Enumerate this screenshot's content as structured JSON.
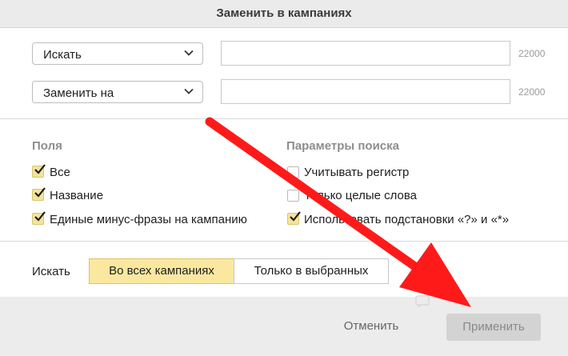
{
  "dialog": {
    "title": "Заменить в кампаниях"
  },
  "find_row": {
    "select_value": "Искать",
    "input_value": "",
    "counter": "22000"
  },
  "replace_row": {
    "select_value": "Заменить на",
    "input_value": "",
    "counter": "22000"
  },
  "fields": {
    "title": "Поля",
    "items": [
      {
        "label": "Все",
        "checked": true
      },
      {
        "label": "Название",
        "checked": true
      },
      {
        "label": "Единые минус-фразы на кампанию",
        "checked": true
      }
    ]
  },
  "search_params": {
    "title": "Параметры поиска",
    "items": [
      {
        "label": "Учитывать регистр",
        "checked": false
      },
      {
        "label": "Только целые слова",
        "checked": false
      },
      {
        "label": "Использовать подстановки «?» и «*»",
        "checked": true
      }
    ]
  },
  "scope": {
    "label": "Искать",
    "options": [
      "Во всех кампаниях",
      "Только в выбранных"
    ],
    "selected": "Во всех кампаниях"
  },
  "footer": {
    "cancel_label": "Отменить",
    "apply_label": "Применить"
  },
  "icons": {
    "chevron": "chevron-down-icon",
    "check": "check-icon",
    "arrow": "red-arrow-annotation"
  },
  "colors": {
    "checkbox_checked": "#f4e49a",
    "segment_active": "#fbe8a0",
    "annotation_arrow": "#ff1a1a"
  }
}
